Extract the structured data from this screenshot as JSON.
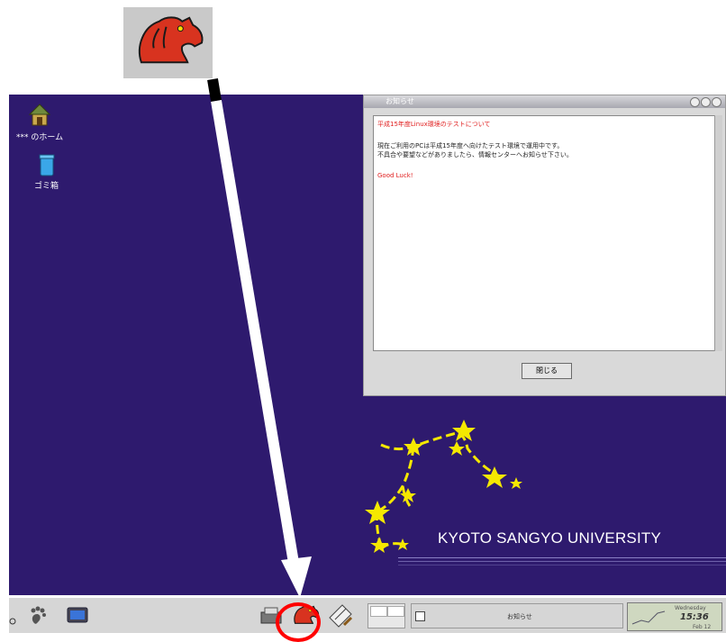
{
  "desktop": {
    "home_label": "*** のホーム",
    "trash_label": "ゴミ箱"
  },
  "message_window": {
    "title": "お知らせ",
    "heading": "平成15年度Linux環境のテストについて",
    "line1": "現在ご利用のPCは平成15年度へ向けたテスト環境で運用中です。",
    "line2": "不具合や要望などがありましたら、情報センターへお知らせ下さい。",
    "good_luck": "Good Luck!",
    "close_label": "閉じる"
  },
  "logo": {
    "text": "KYOTO SANGYO UNIVERSITY"
  },
  "taskbar": {
    "task_label": "お知らせ",
    "clock_day": "Wednesday",
    "clock_time": "15:36",
    "clock_date": "Feb 12"
  },
  "colors": {
    "desktop_bg": "#2e1a6e",
    "highlight": "#ff0000",
    "star": "#f5e800"
  }
}
